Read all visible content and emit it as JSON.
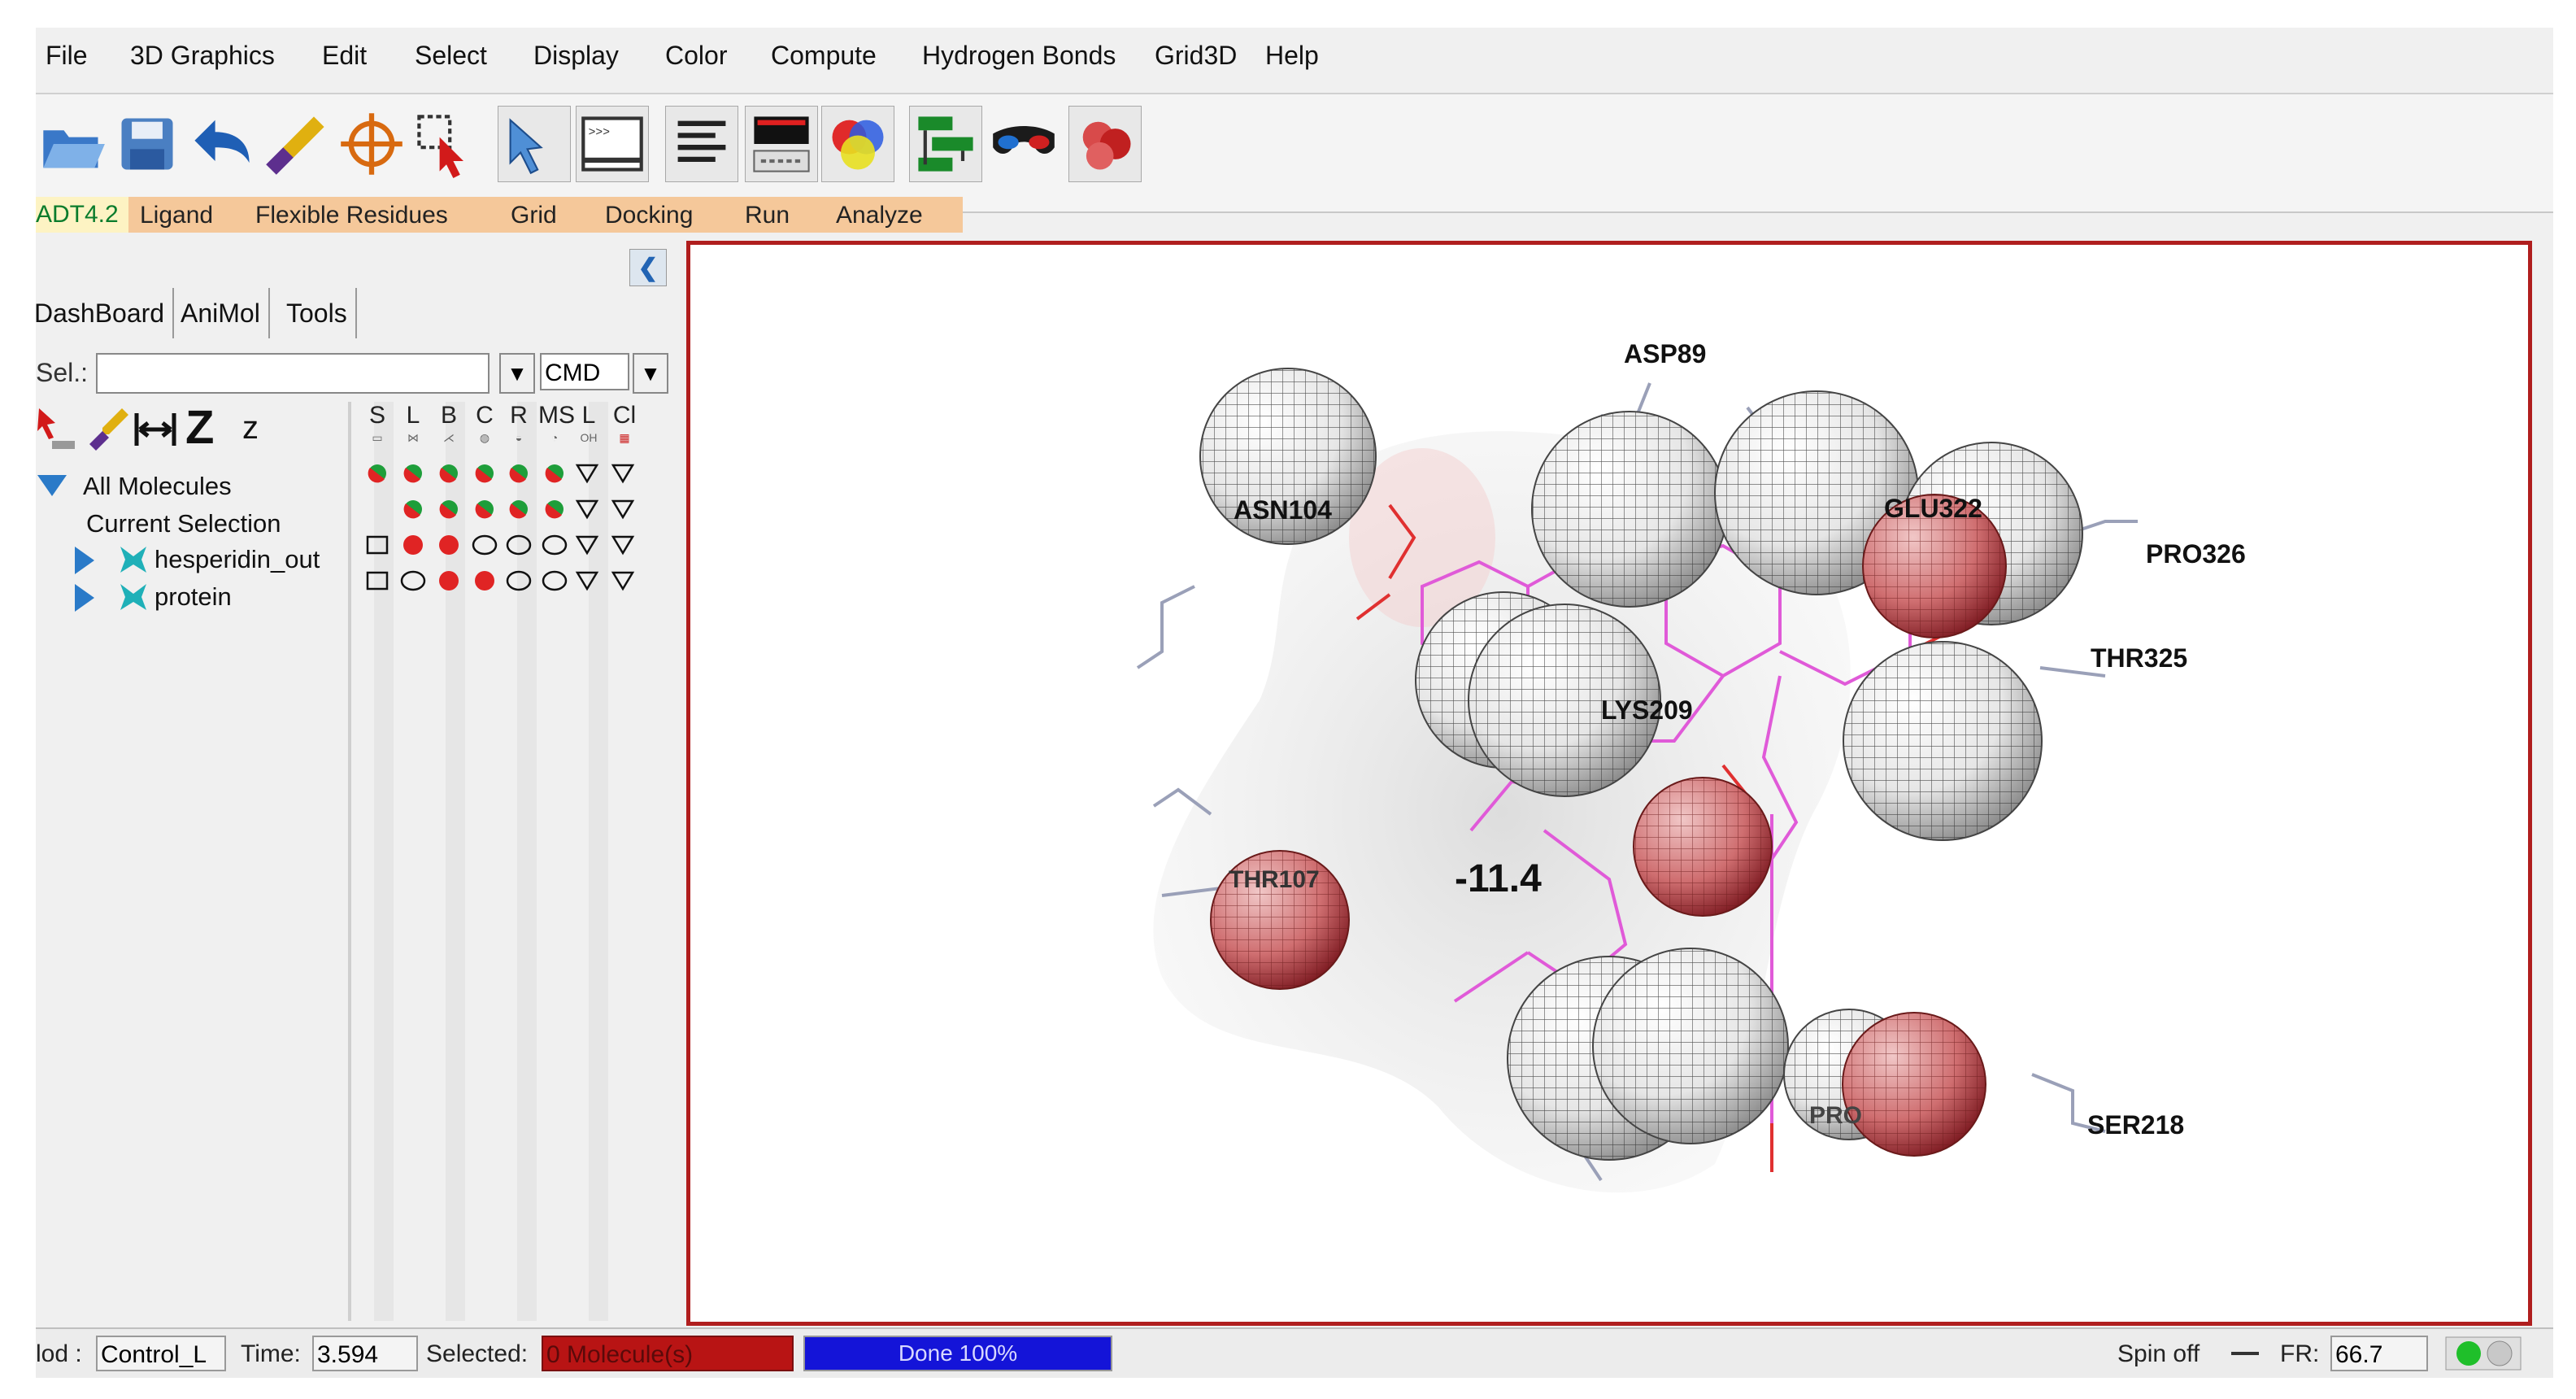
{
  "menu": [
    "File",
    "3D Graphics",
    "Edit",
    "Select",
    "Display",
    "Color",
    "Compute",
    "Hydrogen Bonds",
    "Grid3D",
    "Help"
  ],
  "tool_icons": [
    "open-file-icon",
    "save-icon",
    "undo-icon",
    "dropper-icon",
    "target-icon",
    "select-icon",
    "pointer-icon",
    "python-shell-icon",
    "text-icon",
    "display-panel-icon",
    "color-icon",
    "dashboard-icon",
    "glasses-icon",
    "render-icon"
  ],
  "tabs": [
    "ADT4.2",
    "Ligand",
    "Flexible Residues",
    "Grid",
    "Docking",
    "Run",
    "Analyze"
  ],
  "subtabs": [
    "DashBoard",
    "AniMol",
    "Tools"
  ],
  "sel": {
    "label": "Sel.:",
    "value": "",
    "cmd": "CMD"
  },
  "columns": [
    {
      "head": "S",
      "sub": "▭"
    },
    {
      "head": "L",
      "sub": "⋈"
    },
    {
      "head": "B",
      "sub": "⋌"
    },
    {
      "head": "C",
      "sub": "◍"
    },
    {
      "head": "R",
      "sub": "◒"
    },
    {
      "head": "MS",
      "sub": "◔"
    },
    {
      "head": "L",
      "sub": "OH"
    },
    {
      "head": "Cl",
      "sub": "▦"
    }
  ],
  "tree": {
    "all": "All Molecules",
    "current": "Current Selection",
    "mol1": "hesperidin_out",
    "mol2": "protein"
  },
  "residues": [
    "ASP89",
    "ASN104",
    "GLU322",
    "PRO326",
    "THR325",
    "LYS209",
    "THR107",
    "PRO",
    "SER218"
  ],
  "score": "-11.4",
  "status": {
    "mod_label": "lod :",
    "mod_value": "Control_L",
    "time_label": "Time:",
    "time_value": "3.594",
    "selected_label": "Selected:",
    "selected_value": "0 Molecule(s)",
    "progress_text": "Done 100%",
    "progress": 1.0,
    "spin": "Spin off",
    "fr_label": "FR:",
    "fr_value": "66.7"
  },
  "colors": {
    "viewer_border": "#b01e1e",
    "tab_bar": "#f5c89a",
    "progress": "#1414d8",
    "selected_box": "#b81414",
    "red_atom": "#b2313b",
    "ligand": "#e05ad8"
  }
}
